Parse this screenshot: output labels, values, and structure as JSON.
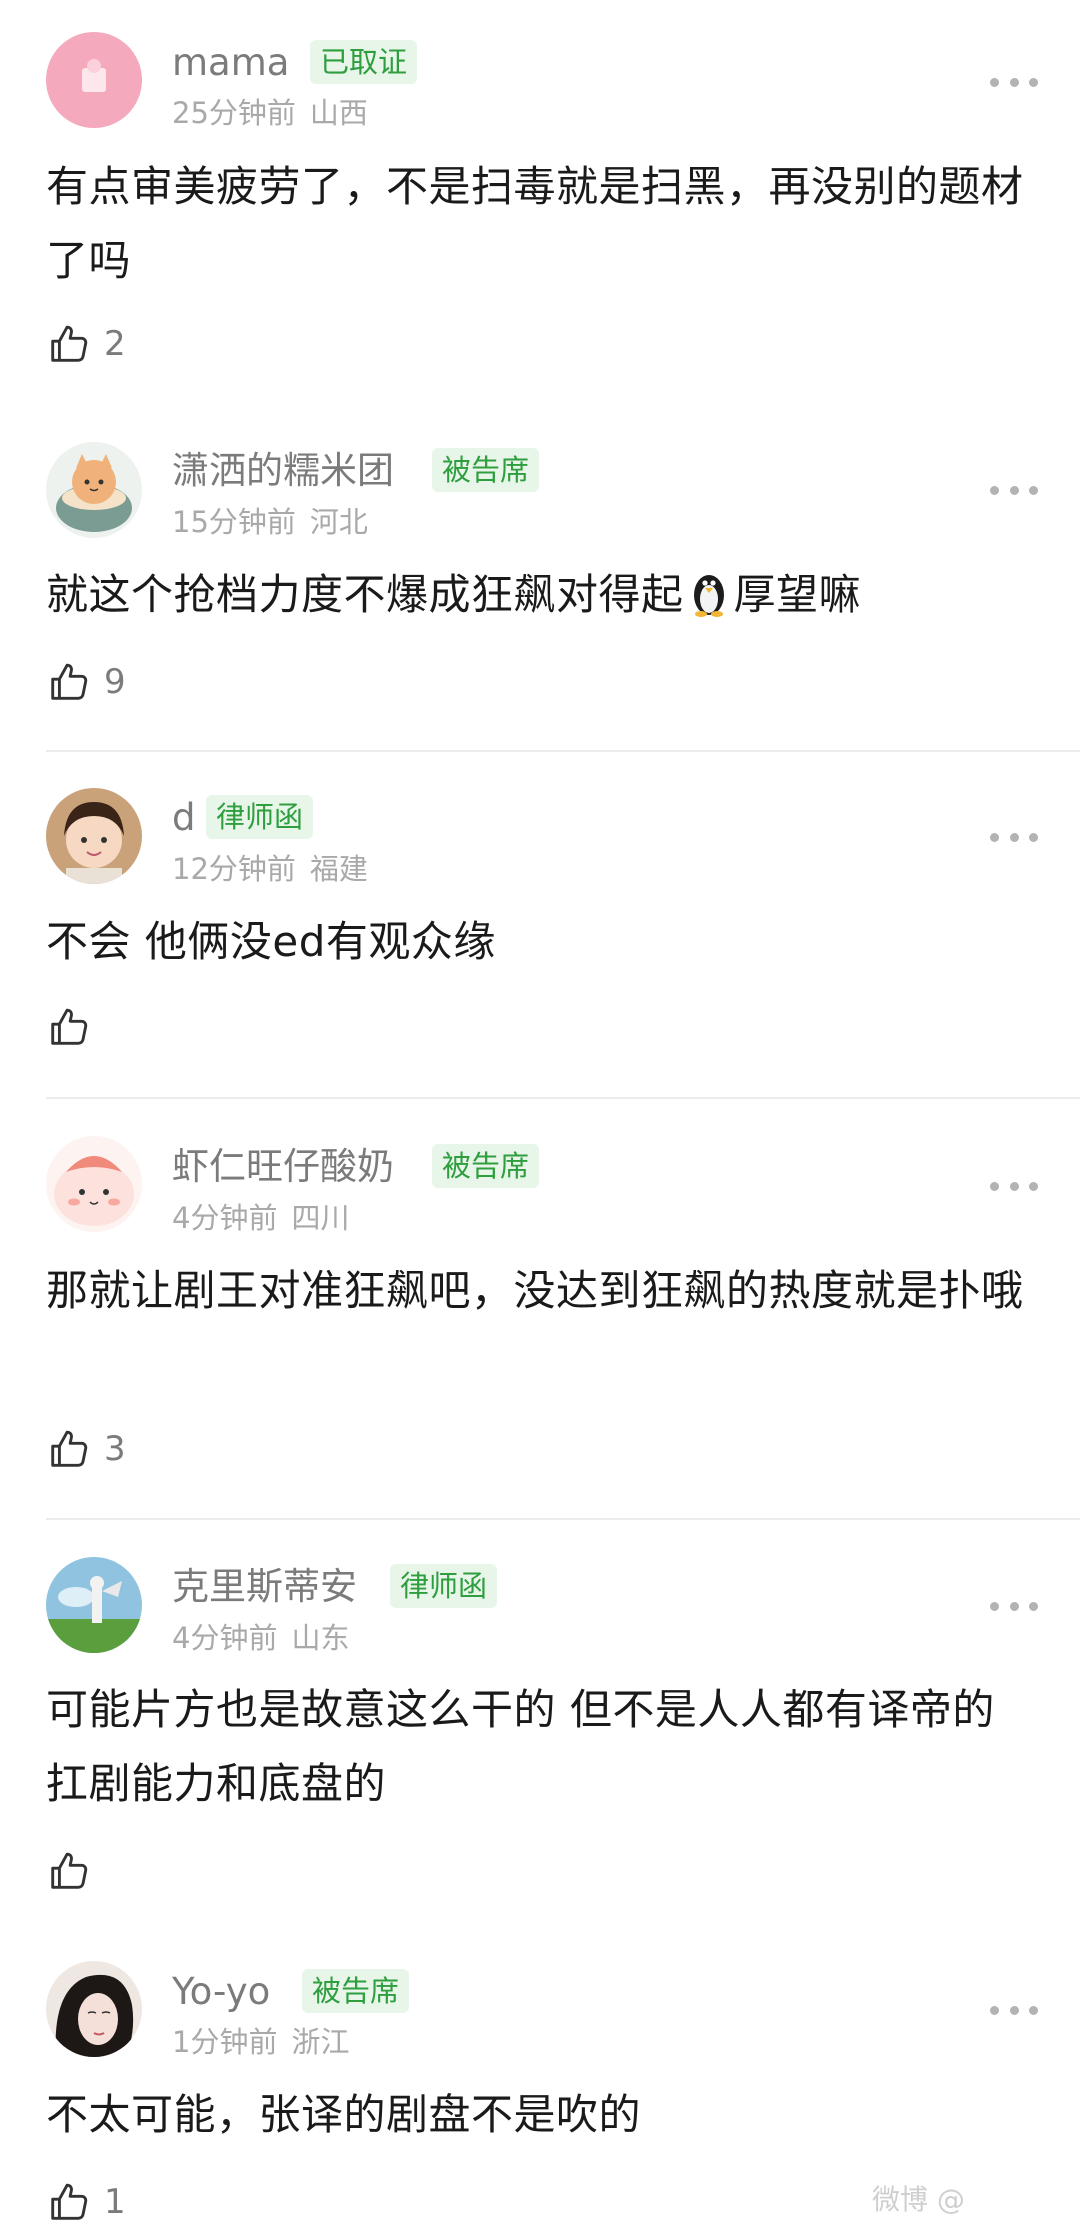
{
  "comments": [
    {
      "username": "mama",
      "badge": "已取证",
      "time": "25分钟前",
      "location": "山西",
      "content": "有点审美疲劳了，不是扫毒就是扫黑，再没别的题材了吗",
      "likes": "2"
    },
    {
      "username": "潇洒的糯米团",
      "badge": "被告席",
      "time": "15分钟前",
      "location": "河北",
      "content_before_emoji": "就这个抢档力度不爆成狂飙对得起",
      "emoji_icon": "penguin-emoji",
      "content_after_emoji": "厚望嘛",
      "likes": "9"
    },
    {
      "username": "d",
      "badge": "律师函",
      "time": "12分钟前",
      "location": "福建",
      "content": "不会 他俩没ed有观众缘",
      "likes": ""
    },
    {
      "username": "虾仁旺仔酸奶",
      "badge": "被告席",
      "time": "4分钟前",
      "location": "四川",
      "content": "那就让剧王对准狂飙吧，没达到狂飙的热度就是扑哦",
      "likes": "3"
    },
    {
      "username": "克里斯蒂安",
      "badge": "律师函",
      "time": "4分钟前",
      "location": "山东",
      "content": "可能片方也是故意这么干的 但不是人人都有译帝的扛剧能力和底盘的",
      "likes": ""
    },
    {
      "username": "Yo-yo",
      "badge": "被告席",
      "time": "1分钟前",
      "location": "浙江",
      "content": "不太可能，张译的剧盘不是吹的",
      "likes": "1"
    }
  ],
  "watermark": "微博 @",
  "colors": {
    "badge_text": "#2f9e3f",
    "badge_bg": "#e8f6ea",
    "username": "#7b7b7b",
    "meta": "#a9a9a9",
    "content": "#1a1a1a"
  },
  "icons": {
    "like": "thumbs-up-icon",
    "more": "more-dots-icon"
  }
}
